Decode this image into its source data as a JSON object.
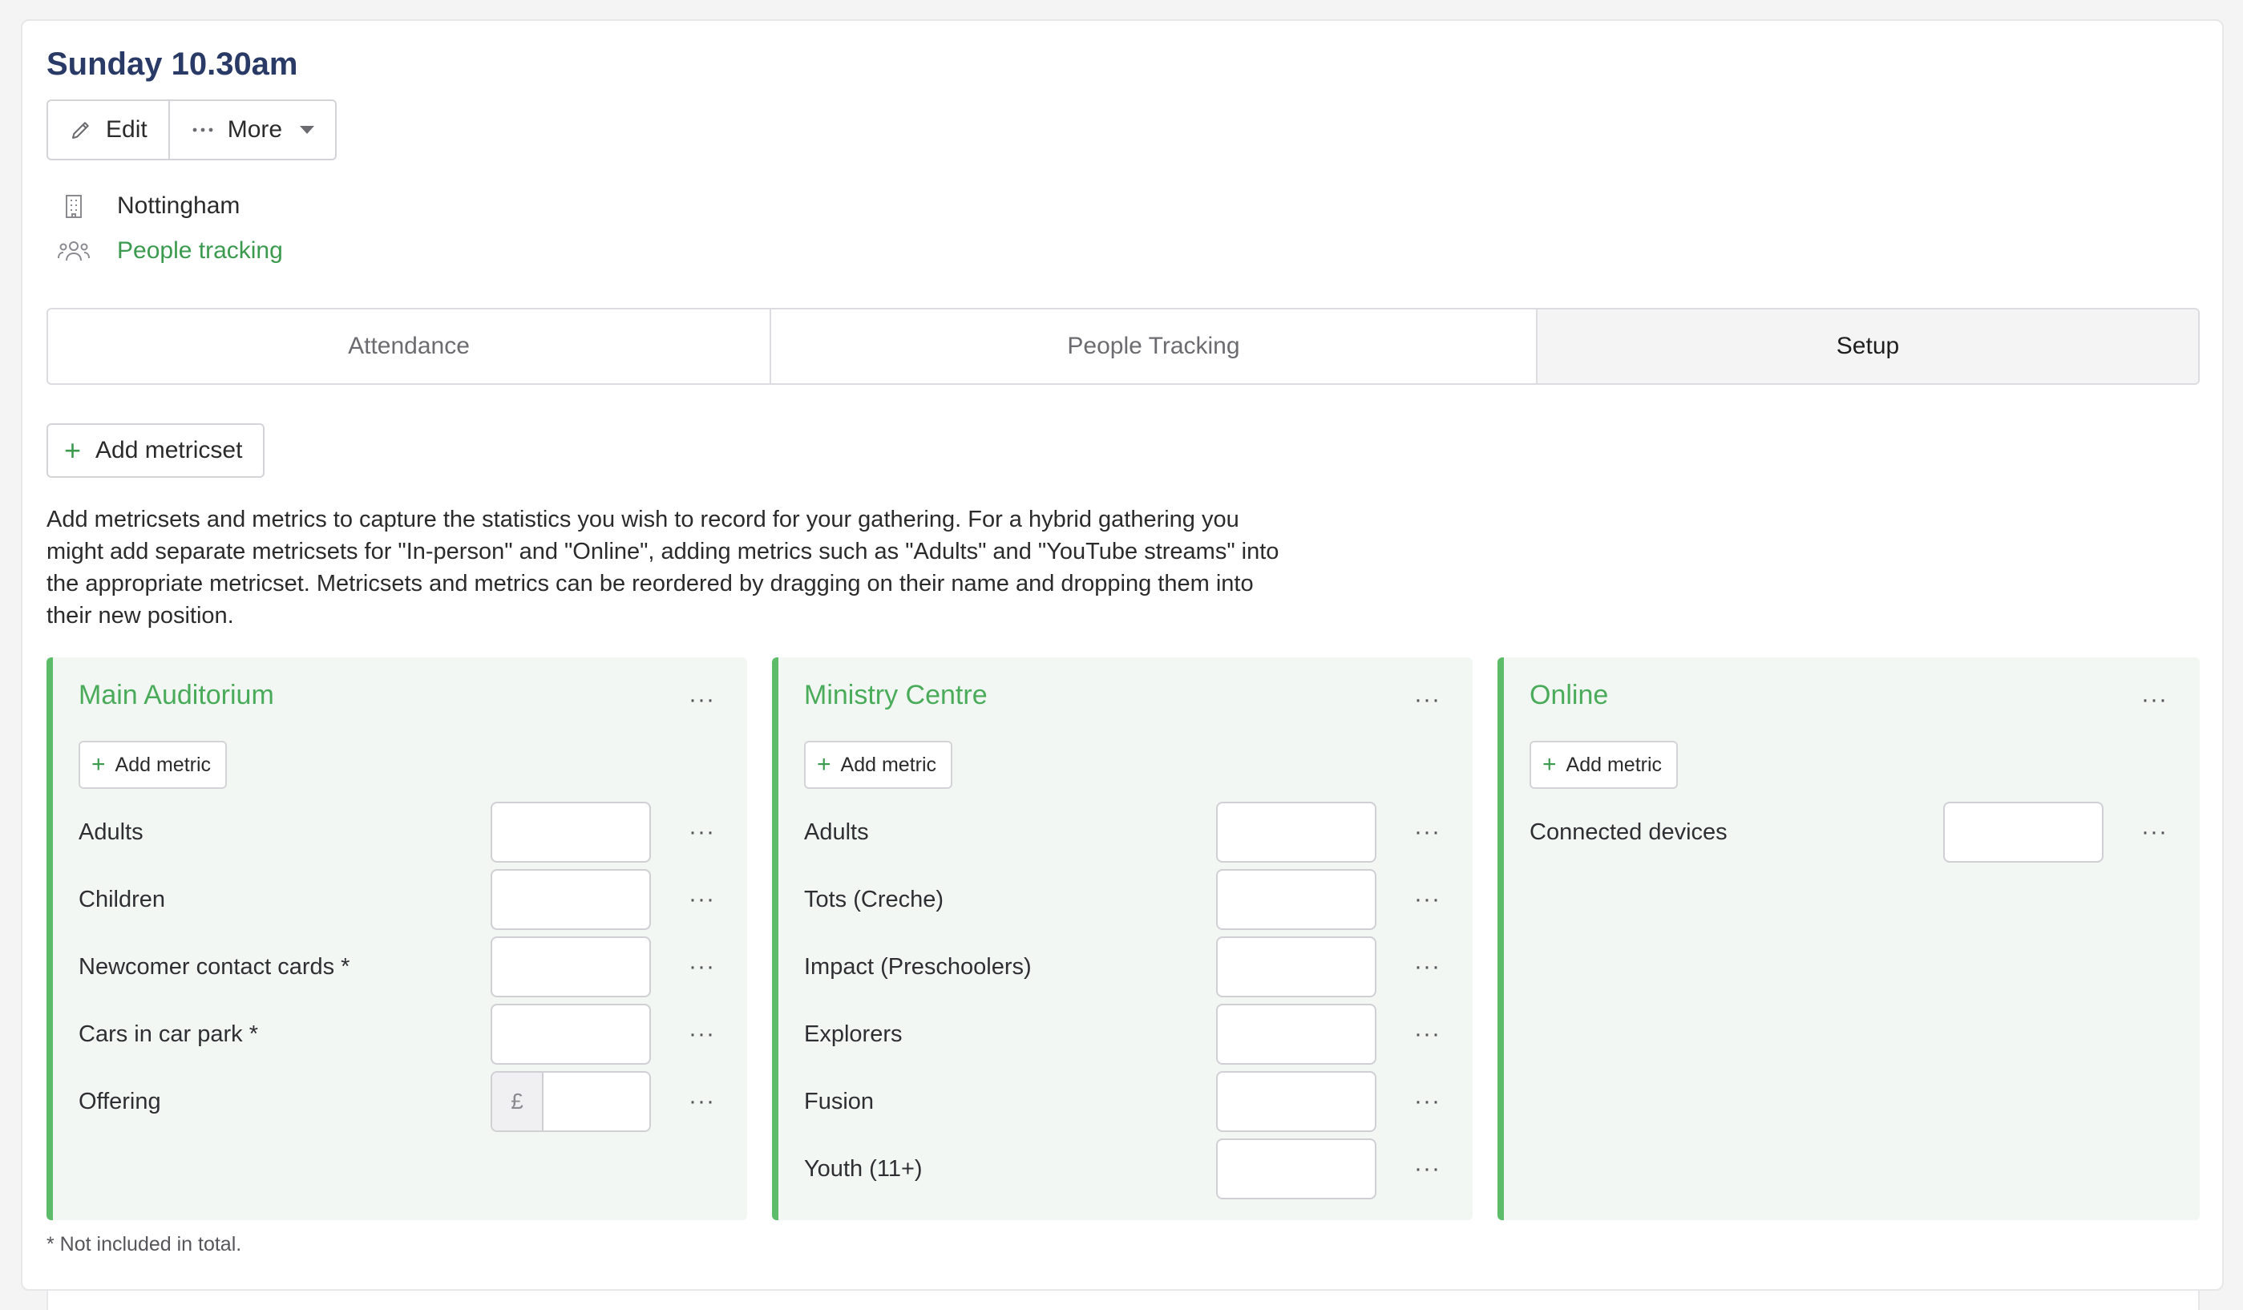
{
  "page": {
    "title": "Sunday 10.30am"
  },
  "toolbar": {
    "edit_label": "Edit",
    "more_label": "More"
  },
  "meta": {
    "location": "Nottingham",
    "people_tracking_link": "People tracking"
  },
  "tabs": [
    {
      "label": "Attendance",
      "active": false
    },
    {
      "label": "People Tracking",
      "active": false
    },
    {
      "label": "Setup",
      "active": true
    }
  ],
  "setup": {
    "add_metricset_label": "Add metricset",
    "help_text": "Add metricsets and metrics to capture the statistics you wish to record for your gathering. For a hybrid gathering you might add separate metricsets for \"In-person\" and \"Online\", adding metrics such as \"Adults\" and \"YouTube streams\" into the appropriate metricset. Metricsets and metrics can be reordered by dragging on their name and dropping them into their new position.",
    "add_metric_label": "Add metric",
    "menu_glyph": "···",
    "currency_symbol": "£",
    "footnote": "* Not included in total.",
    "metricsets": [
      {
        "name": "Main Auditorium",
        "metrics": [
          {
            "label": "Adults",
            "value": ""
          },
          {
            "label": "Children",
            "value": ""
          },
          {
            "label": "Newcomer contact cards *",
            "value": ""
          },
          {
            "label": "Cars in car park *",
            "value": ""
          },
          {
            "label": "Offering",
            "value": "",
            "currency": true
          }
        ]
      },
      {
        "name": "Ministry Centre",
        "metrics": [
          {
            "label": "Adults",
            "value": ""
          },
          {
            "label": "Tots (Creche)",
            "value": ""
          },
          {
            "label": "Impact (Preschoolers)",
            "value": ""
          },
          {
            "label": "Explorers",
            "value": ""
          },
          {
            "label": "Fusion",
            "value": ""
          },
          {
            "label": "Youth (11+)",
            "value": ""
          }
        ]
      },
      {
        "name": "Online",
        "metrics": [
          {
            "label": "Connected devices",
            "value": ""
          }
        ]
      }
    ]
  },
  "colors": {
    "accent_green": "#3c9a4f",
    "metricset_border": "#5cbc6a",
    "metricset_bg": "#f2f7f3",
    "title_navy": "#2a3a66"
  }
}
